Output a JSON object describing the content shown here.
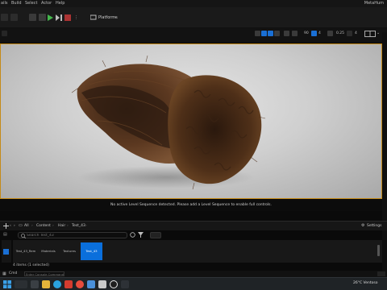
{
  "menubar": {
    "items": [
      "ails",
      "Build",
      "Select",
      "Actor",
      "Help"
    ],
    "app_title": "MetaHum"
  },
  "toolbar": {
    "platforms_label": "Platforms"
  },
  "viewport_bar": {
    "fov_value": "90",
    "speed_value": "0.25",
    "grid_value": "4"
  },
  "viewport": {
    "sequence_message": "No active Level Sequence detected. Please add a Level Sequence to enable full controls."
  },
  "content_browser": {
    "breadcrumbs": [
      "All",
      "Content",
      "Hair",
      "Test_43"
    ],
    "settings_label": "Settings",
    "search_placeholder": "Search Test_43",
    "assets": [
      {
        "label": "Test_43_Rem",
        "selected": false
      },
      {
        "label": "Materials",
        "selected": false
      },
      {
        "label": "Textures",
        "selected": false
      },
      {
        "label": "Test_43",
        "selected": true
      }
    ],
    "status": "4 items (1 selected)"
  },
  "command_bar": {
    "cmd_label": "Cmd",
    "input_placeholder": "Enter Console Command"
  },
  "taskbar": {
    "weather": "26°C  Ventoso",
    "colors": {
      "edge": "#2aa3e0",
      "folder": "#e5b43a",
      "chrome": "#e74c3c",
      "unreal": "#eaeaea"
    }
  },
  "colors": {
    "viewport_border": "#c58a17",
    "selected_asset": "#0a6fdc",
    "play_button": "#43b64b"
  }
}
